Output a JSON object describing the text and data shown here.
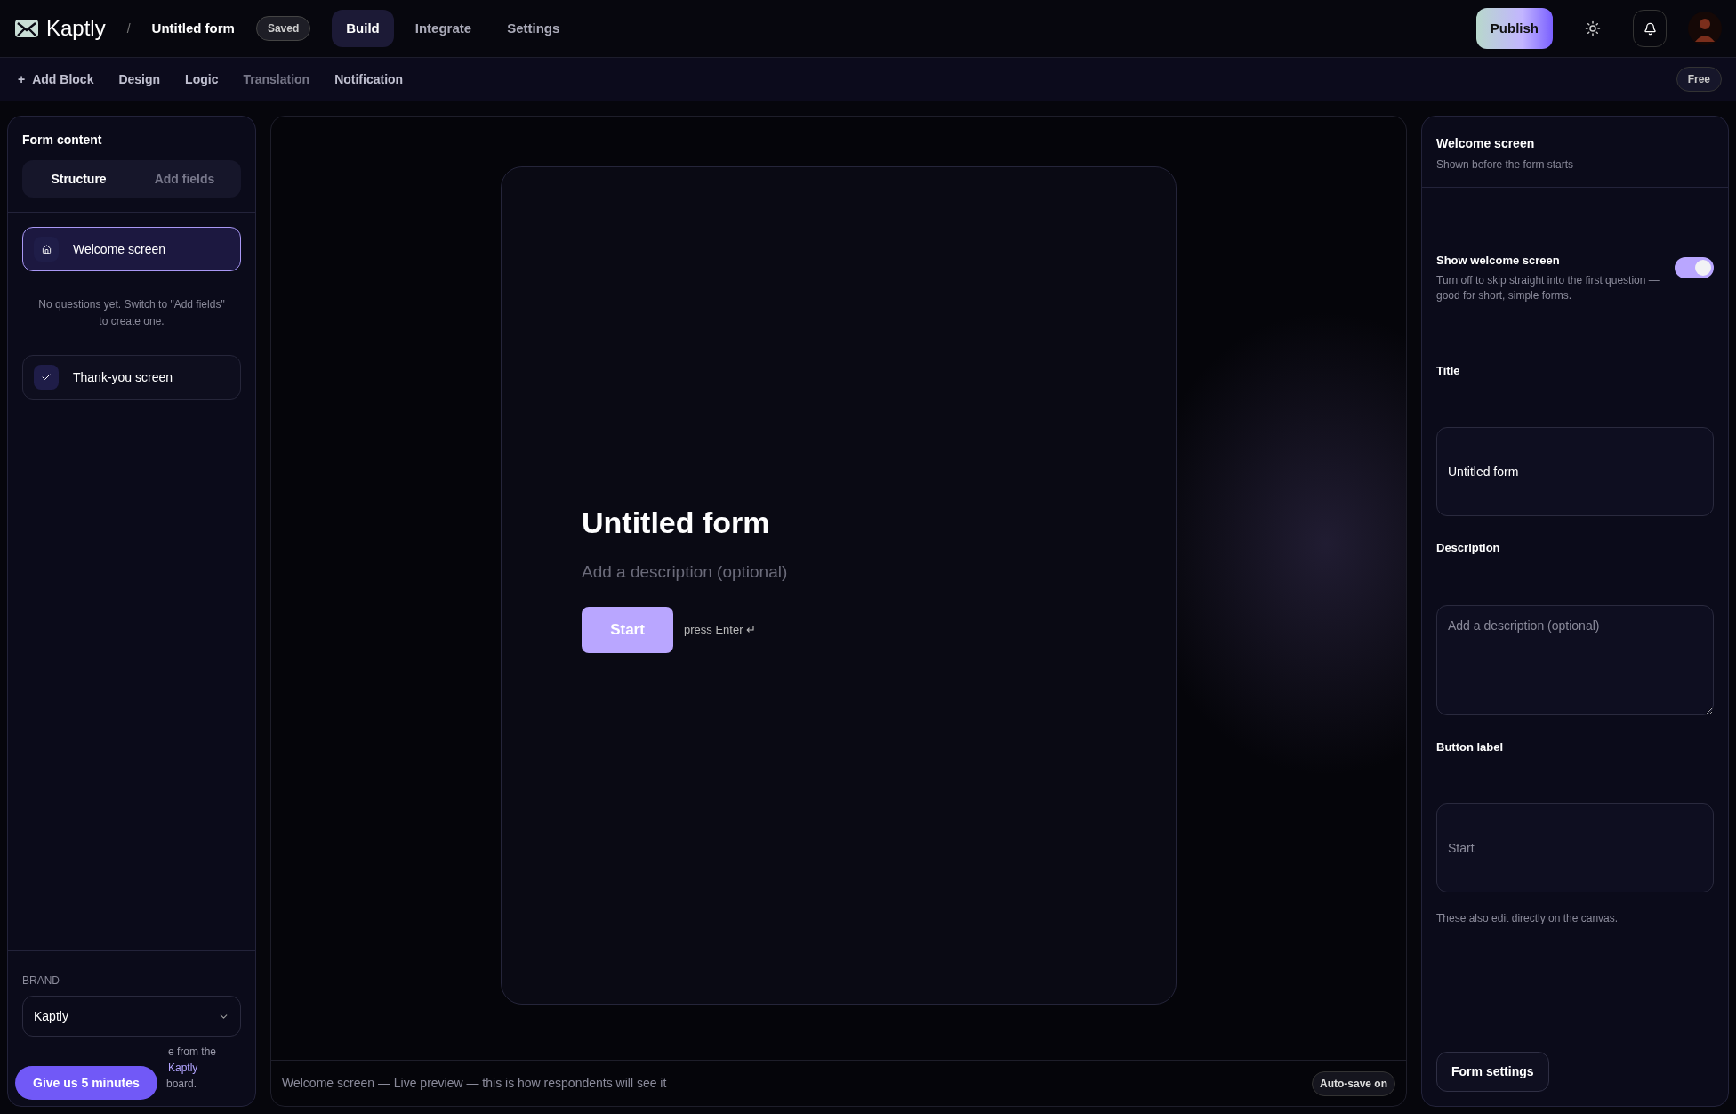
{
  "app": {
    "name": "Kaptly",
    "separator": "/",
    "form_title": "Untitled form",
    "save_status": "Saved"
  },
  "nav_tabs": [
    {
      "label": "Build",
      "selected": true
    },
    {
      "label": "Integrate",
      "selected": false
    },
    {
      "label": "Settings",
      "selected": false
    }
  ],
  "publish_button": "Publish",
  "toolbar": [
    {
      "label": "Add Block",
      "icon": "+",
      "disabled": false
    },
    {
      "label": "Design",
      "disabled": false
    },
    {
      "label": "Logic",
      "disabled": false
    },
    {
      "label": "Translation",
      "disabled": true
    },
    {
      "label": "Notification",
      "disabled": false
    }
  ],
  "plan_badge": "Free",
  "sidebar": {
    "title": "Form content",
    "tabs": [
      {
        "label": "Structure",
        "selected": true
      },
      {
        "label": "Add fields",
        "selected": false
      }
    ],
    "items": [
      {
        "label": "Welcome screen",
        "kind": "welcome",
        "selected": true
      },
      {
        "label": "Thank-you screen",
        "kind": "thanks",
        "selected": false
      }
    ],
    "empty_note": "No questions yet. Switch to \"Add fields\" to create one.",
    "brand_label": "BRAND",
    "brand_value": "Kaptly",
    "brand_help_line_1": "e from the",
    "brand_help_link": "Kaptly",
    "brand_help_line_2": "board."
  },
  "feedback_button": "Give us 5 minutes",
  "preview": {
    "title": "Untitled form",
    "description": "Add a description (optional)",
    "button": "Start",
    "hint": "press Enter ↵",
    "footer": "Welcome screen — Live preview — this is how respondents will see it",
    "autosave": "Auto-save on"
  },
  "inspector": {
    "title": "Welcome screen",
    "subtitle": "Shown before the form starts",
    "toggle": {
      "label": "Show welcome screen",
      "description": "Turn off to skip straight into the first question — good for short, simple forms.",
      "on": true
    },
    "fields": [
      {
        "label": "Title",
        "value": "Untitled form",
        "kind": "input"
      },
      {
        "label": "Description",
        "placeholder": "Add a description (optional)",
        "kind": "textarea"
      },
      {
        "label": "Button label",
        "placeholder": "Start",
        "kind": "input"
      }
    ],
    "note": "These also edit directly on the canvas.",
    "settings_button": "Form settings"
  }
}
